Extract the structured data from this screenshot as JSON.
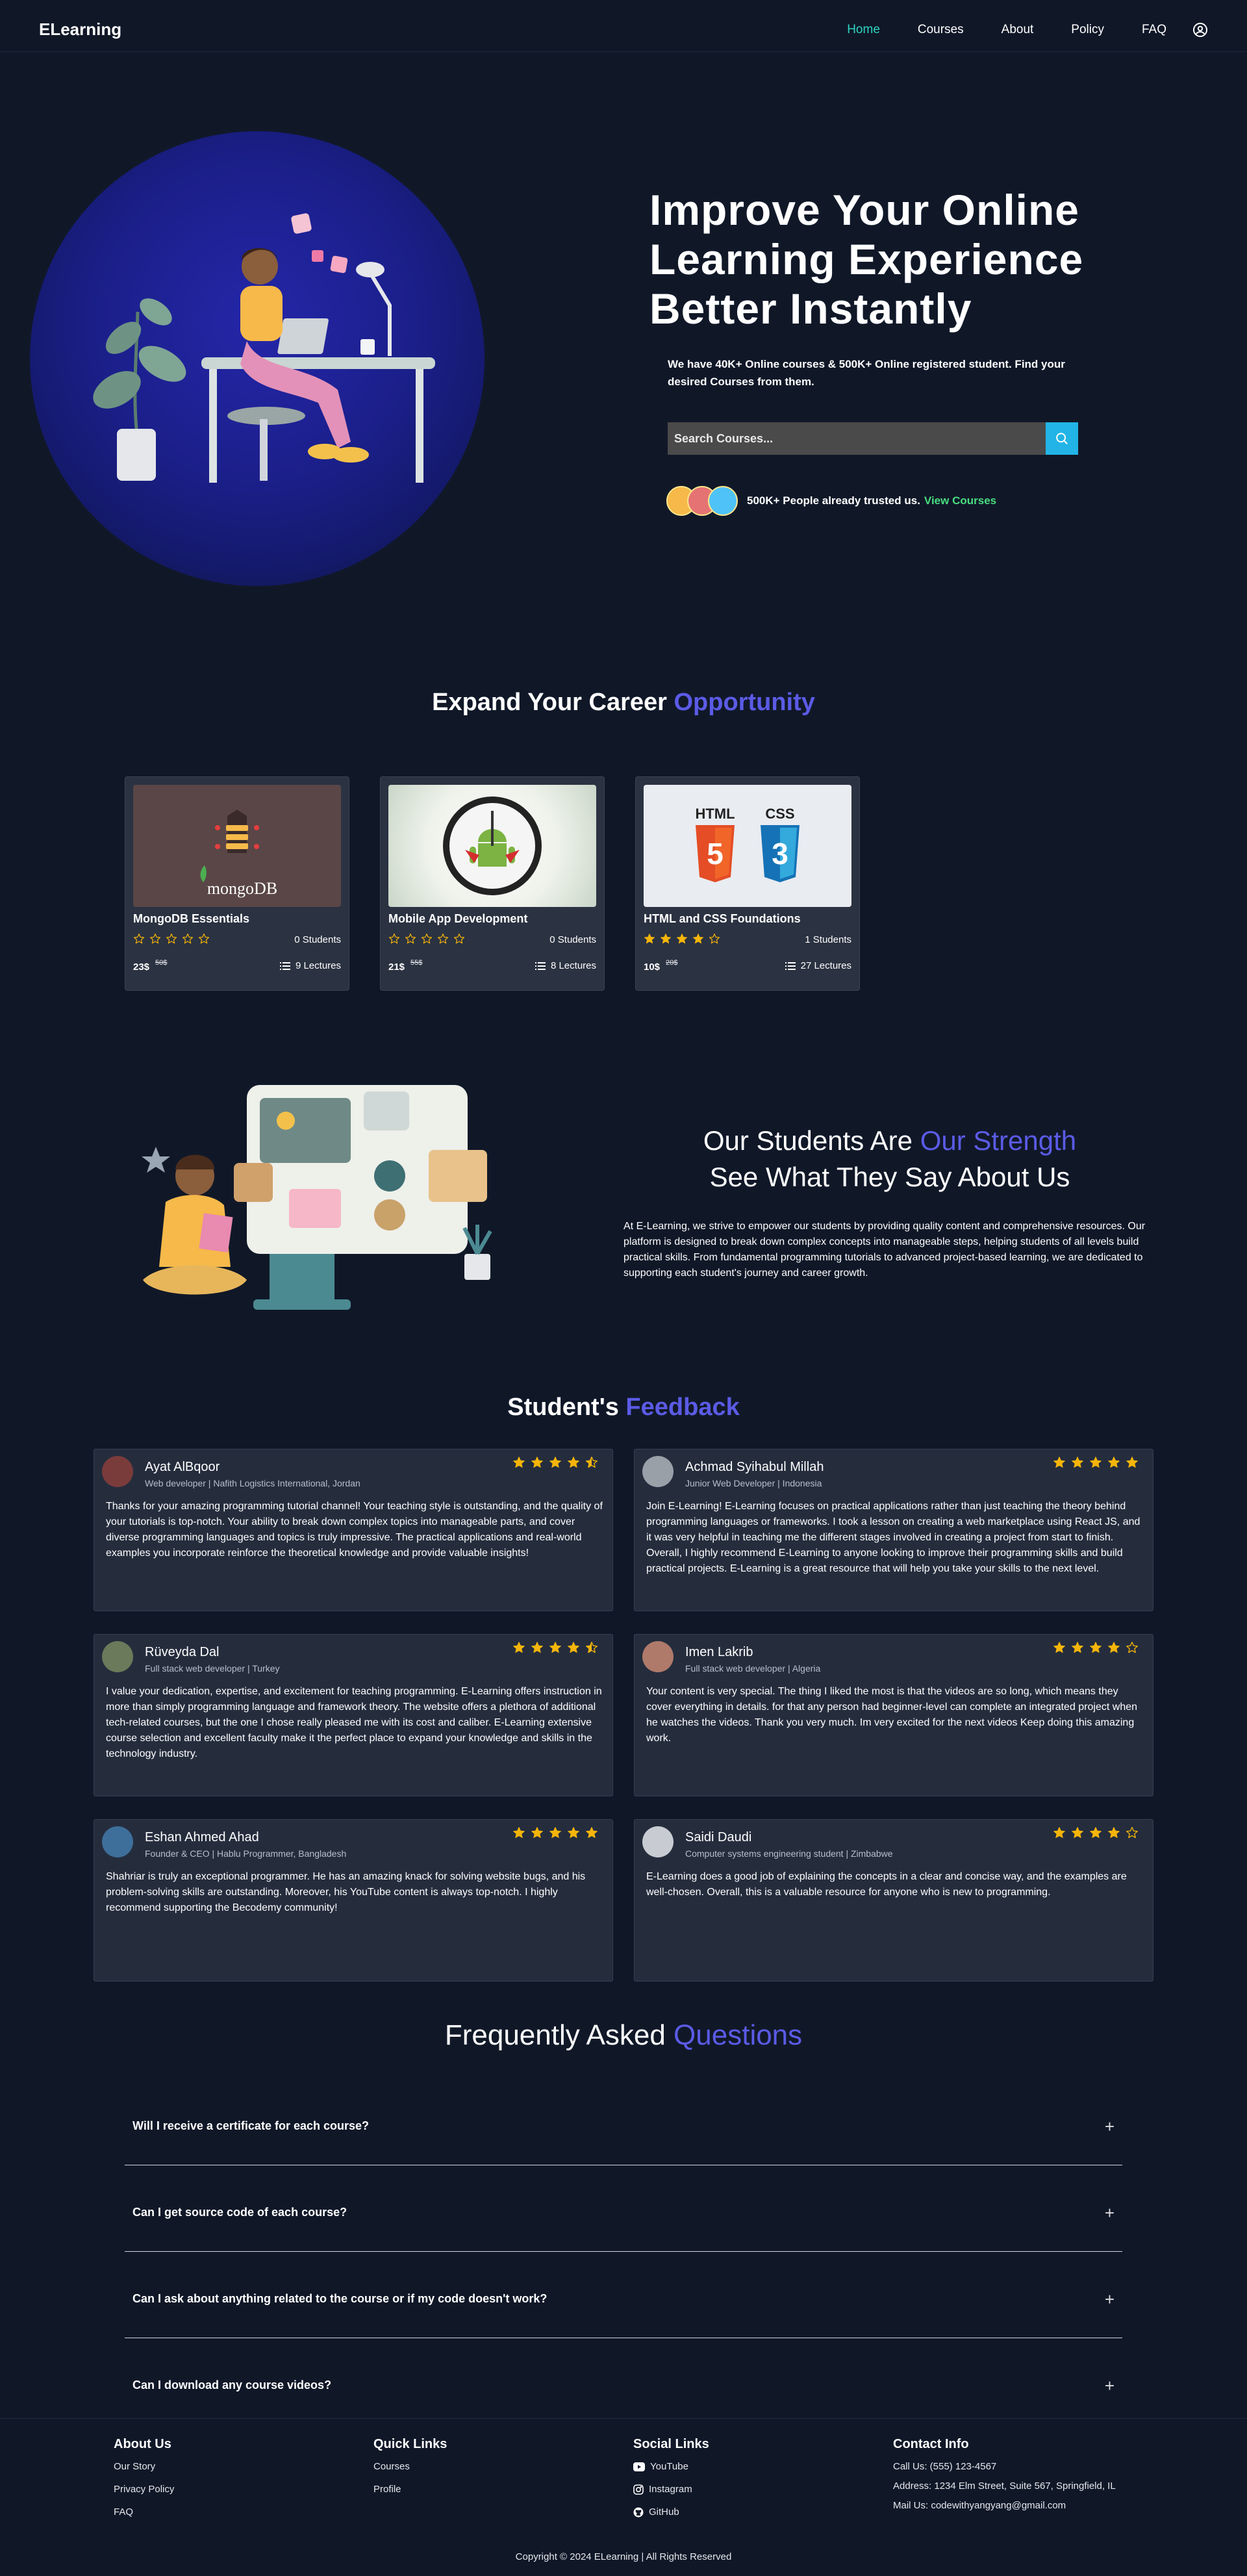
{
  "nav": {
    "logo": "ELearning",
    "links": [
      "Home",
      "Courses",
      "About",
      "Policy",
      "FAQ"
    ],
    "active": "Home"
  },
  "hero": {
    "title": "Improve Your Online Learning Experience Better Instantly",
    "subtitle": "We have 40K+ Online courses & 500K+ Online registered student. Find your desired Courses from them.",
    "search_placeholder": "Search Courses...",
    "trust_text": "500K+ People already trusted us.",
    "trust_link": "View Courses"
  },
  "courses_section": {
    "title_plain": "Expand Your Career ",
    "title_accent": "Opportunity",
    "courses": [
      {
        "name": "MongoDB Essentials",
        "rating": 0,
        "students": "0 Students",
        "price": "23$",
        "old_price": "50$",
        "lectures": "9 Lectures",
        "thumb_label": "mongoDB"
      },
      {
        "name": "Mobile App Development",
        "rating": 0,
        "students": "0 Students",
        "price": "21$",
        "old_price": "55$",
        "lectures": "8 Lectures"
      },
      {
        "name": "HTML and CSS Foundations",
        "rating": 4,
        "students": "1 Students",
        "price": "10$",
        "old_price": "20$",
        "lectures": "27 Lectures",
        "thumb_html": "HTML",
        "thumb_css": "CSS"
      }
    ]
  },
  "strength": {
    "line1_plain": "Our Students Are ",
    "line1_accent": "Our Strength",
    "line2": "See What They Say About Us",
    "text": "At E-Learning, we strive to empower our students by providing quality content and comprehensive resources. Our platform is designed to break down complex concepts into manageable steps, helping students of all levels build practical skills. From fundamental programming tutorials to advanced project-based learning, we are dedicated to supporting each student's journey and career growth."
  },
  "feedback": {
    "title_plain": "Student's ",
    "title_accent": "Feedback",
    "items": [
      {
        "name": "Ayat AlBqoor",
        "role": "Web developer | Nafith Logistics International, Jordan",
        "rating": 4.5,
        "text": "Thanks for your amazing programming tutorial channel! Your teaching style is outstanding, and the quality of your tutorials is top-notch. Your ability to break down complex topics into manageable parts, and cover diverse programming languages and topics is truly impressive. The practical applications and real-world examples you incorporate reinforce the theoretical knowledge and provide valuable insights!"
      },
      {
        "name": "Achmad Syihabul Millah",
        "role": "Junior Web Developer | Indonesia",
        "rating": 5,
        "text": "Join E-Learning! E-Learning focuses on practical applications rather than just teaching the theory behind programming languages or frameworks. I took a lesson on creating a web marketplace using React JS, and it was very helpful in teaching me the different stages involved in creating a project from start to finish. Overall, I highly recommend E-Learning to anyone looking to improve their programming skills and build practical projects. E-Learning is a great resource that will help you take your skills to the next level."
      },
      {
        "name": "Rüveyda Dal",
        "role": "Full stack web developer | Turkey",
        "rating": 4.5,
        "text": "I value your dedication, expertise, and excitement for teaching programming. E-Learning offers instruction in more than simply programming language and framework theory. The website offers a plethora of additional tech-related courses, but the one I chose really pleased me with its cost and caliber. E-Learning extensive course selection and excellent faculty make it the perfect place to expand your knowledge and skills in the technology industry."
      },
      {
        "name": "Imen Lakrib",
        "role": "Full stack web developer | Algeria",
        "rating": 4,
        "text": "Your content is very special. The thing I liked the most is that the videos are so long, which means they cover everything in details. for that any person had beginner-level can complete an integrated project when he watches the videos. Thank you very much. Im very excited for the next videos Keep doing this amazing work."
      },
      {
        "name": "Eshan Ahmed Ahad",
        "role": "Founder & CEO | Hablu Programmer, Bangladesh",
        "rating": 5,
        "text": "Shahriar is truly an exceptional programmer. He has an amazing knack for solving website bugs, and his problem-solving skills are outstanding. Moreover, his YouTube content is always top-notch. I highly recommend supporting the Becodemy community!"
      },
      {
        "name": "Saidi Daudi",
        "role": "Computer systems engineering student | Zimbabwe",
        "rating": 4,
        "text": "E-Learning does a good job of explaining the concepts in a clear and concise way, and the examples are well-chosen. Overall, this is a valuable resource for anyone who is new to programming."
      }
    ]
  },
  "faq": {
    "title_plain": "Frequently Asked ",
    "title_accent": "Questions",
    "questions": [
      "Will I receive a certificate for each course?",
      "Can I get source code of each course?",
      "Can I ask about anything related to the course or if my code doesn't work?",
      "Can I download any course videos?"
    ]
  },
  "footer": {
    "about": {
      "heading": "About Us",
      "items": [
        "Our Story",
        "Privacy Policy",
        "FAQ"
      ]
    },
    "quick": {
      "heading": "Quick Links",
      "items": [
        "Courses",
        "Profile"
      ]
    },
    "social": {
      "heading": "Social Links",
      "items": [
        "YouTube",
        "Instagram",
        "GitHub"
      ]
    },
    "contact": {
      "heading": "Contact Info",
      "items": [
        "Call Us: (555) 123-4567",
        "Address: 1234 Elm Street, Suite 567, Springfield, IL",
        "Mail Us: codewithyangyang@gmail.com"
      ]
    },
    "copyright": "Copyright © 2024 ELearning | All Rights Reserved"
  },
  "colors": {
    "background": "#101828",
    "accent": "#5b5be6",
    "active_nav": "#2dd4bf",
    "star": "#f5b50a",
    "search_button": "#22b4e6",
    "trust_link": "#4ade80"
  }
}
